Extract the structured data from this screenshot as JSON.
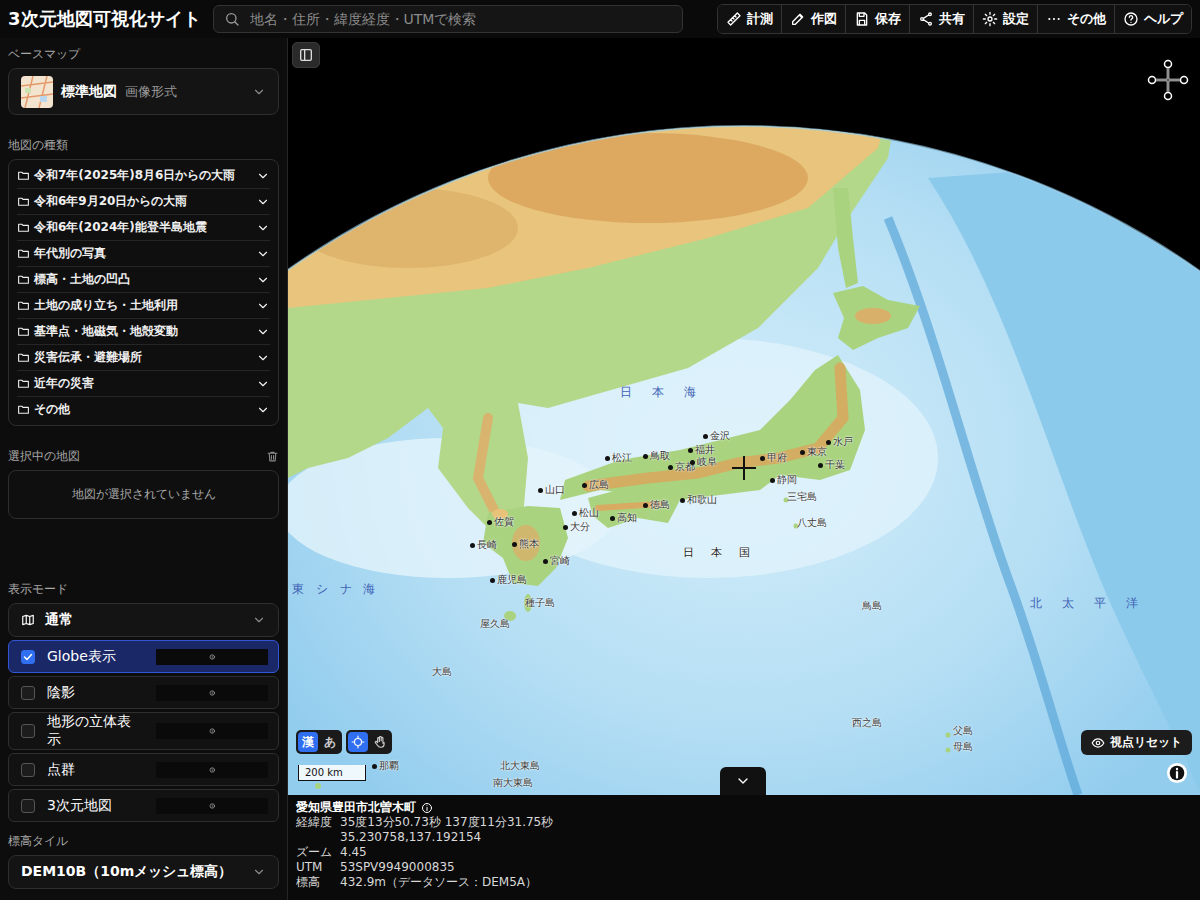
{
  "header": {
    "title": "3次元地図可視化サイト",
    "search_placeholder": "地名・住所・緯度経度・UTMで検索",
    "buttons": [
      "計測",
      "作図",
      "保存",
      "共有",
      "設定",
      "その他",
      "ヘルプ"
    ]
  },
  "sidebar": {
    "basemap": {
      "section": "ベースマップ",
      "name": "標準地図",
      "format": "画像形式"
    },
    "map_types": {
      "section": "地図の種類",
      "items": [
        {
          "label": "令和7年(2025年)8月6日からの大雨",
          "expanded": false
        },
        {
          "label": "令和6年9月20日からの大雨",
          "expanded": false
        },
        {
          "label": "令和6年(2024年)能登半島地震",
          "expanded": false
        },
        {
          "label": "年代別の写真",
          "expanded": false
        },
        {
          "label": "標高・土地の凹凸",
          "expanded": false
        },
        {
          "label": "土地の成り立ち・土地利用",
          "expanded": false
        },
        {
          "label": "基準点・地磁気・地殻変動",
          "expanded": false
        },
        {
          "label": "災害伝承・避難場所",
          "expanded": false
        },
        {
          "label": "近年の災害",
          "expanded": false
        },
        {
          "label": "その他",
          "expanded": false
        }
      ]
    },
    "selected_maps": {
      "section": "選択中の地図",
      "empty": "地図が選択されていません"
    },
    "display_mode": {
      "section": "表示モード",
      "mode": "通常",
      "options": [
        {
          "label": "Globe表示",
          "checked": true
        },
        {
          "label": "陰影",
          "checked": false
        },
        {
          "label": "地形の立体表示",
          "checked": false
        },
        {
          "label": "点群",
          "checked": false
        },
        {
          "label": "3次元地図",
          "checked": false
        }
      ]
    },
    "elevation_tile": {
      "section": "標高タイル",
      "value": "DEM10B（10mメッシュ標高）"
    }
  },
  "map": {
    "labels": [
      {
        "text": "日　本　海",
        "kind": "sea"
      },
      {
        "text": "北　太　平　洋",
        "kind": "sea"
      },
      {
        "text": "東 シ ナ 海",
        "kind": "sea"
      },
      {
        "text": "日　本　国",
        "kind": "country"
      },
      {
        "text": "金沢",
        "kind": "city"
      },
      {
        "text": "福井",
        "kind": "city"
      },
      {
        "text": "松江",
        "kind": "city"
      },
      {
        "text": "鳥取",
        "kind": "city"
      },
      {
        "text": "山口",
        "kind": "city"
      },
      {
        "text": "広島",
        "kind": "city"
      },
      {
        "text": "松山",
        "kind": "city"
      },
      {
        "text": "高知",
        "kind": "city"
      },
      {
        "text": "徳島",
        "kind": "city"
      },
      {
        "text": "和歌山",
        "kind": "city"
      },
      {
        "text": "京都",
        "kind": "city"
      },
      {
        "text": "岐阜",
        "kind": "city"
      },
      {
        "text": "甲府",
        "kind": "city"
      },
      {
        "text": "静岡",
        "kind": "city"
      },
      {
        "text": "東京",
        "kind": "city"
      },
      {
        "text": "千葉",
        "kind": "city"
      },
      {
        "text": "水戸",
        "kind": "city"
      },
      {
        "text": "佐賀",
        "kind": "city"
      },
      {
        "text": "長崎",
        "kind": "city"
      },
      {
        "text": "熊本",
        "kind": "city"
      },
      {
        "text": "大分",
        "kind": "city"
      },
      {
        "text": "宮崎",
        "kind": "city"
      },
      {
        "text": "鹿児島",
        "kind": "city"
      },
      {
        "text": "種子島",
        "kind": "island"
      },
      {
        "text": "屋久島",
        "kind": "island"
      },
      {
        "text": "大島",
        "kind": "island"
      },
      {
        "text": "三宅島",
        "kind": "island"
      },
      {
        "text": "八丈島",
        "kind": "island"
      },
      {
        "text": "鳥島",
        "kind": "island"
      },
      {
        "text": "西之島",
        "kind": "island"
      },
      {
        "text": "父島",
        "kind": "island"
      },
      {
        "text": "母島",
        "kind": "island"
      },
      {
        "text": "北大東島",
        "kind": "island"
      },
      {
        "text": "南大東島",
        "kind": "island"
      },
      {
        "text": "那覇",
        "kind": "city"
      }
    ],
    "label_toggle": [
      {
        "label": "漢",
        "selected": true
      },
      {
        "label": "あ",
        "selected": false
      }
    ],
    "pick_modes": [
      {
        "selected": true
      },
      {
        "selected": false
      }
    ],
    "scale": "200 km",
    "reset_view": "視点リセット"
  },
  "info_panel": {
    "place": "愛知県豊田市北曽木町",
    "rows": [
      {
        "key": "経緯度",
        "values": [
          "35度13分50.73秒 137度11分31.75秒",
          "35.230758,137.192154"
        ]
      },
      {
        "key": "ズーム",
        "values": [
          "4.45"
        ]
      },
      {
        "key": "UTM",
        "values": [
          "53SPV9949000835"
        ]
      },
      {
        "key": "標高",
        "values": [
          "432.9m（データソース：DEM5A）"
        ]
      }
    ]
  }
}
